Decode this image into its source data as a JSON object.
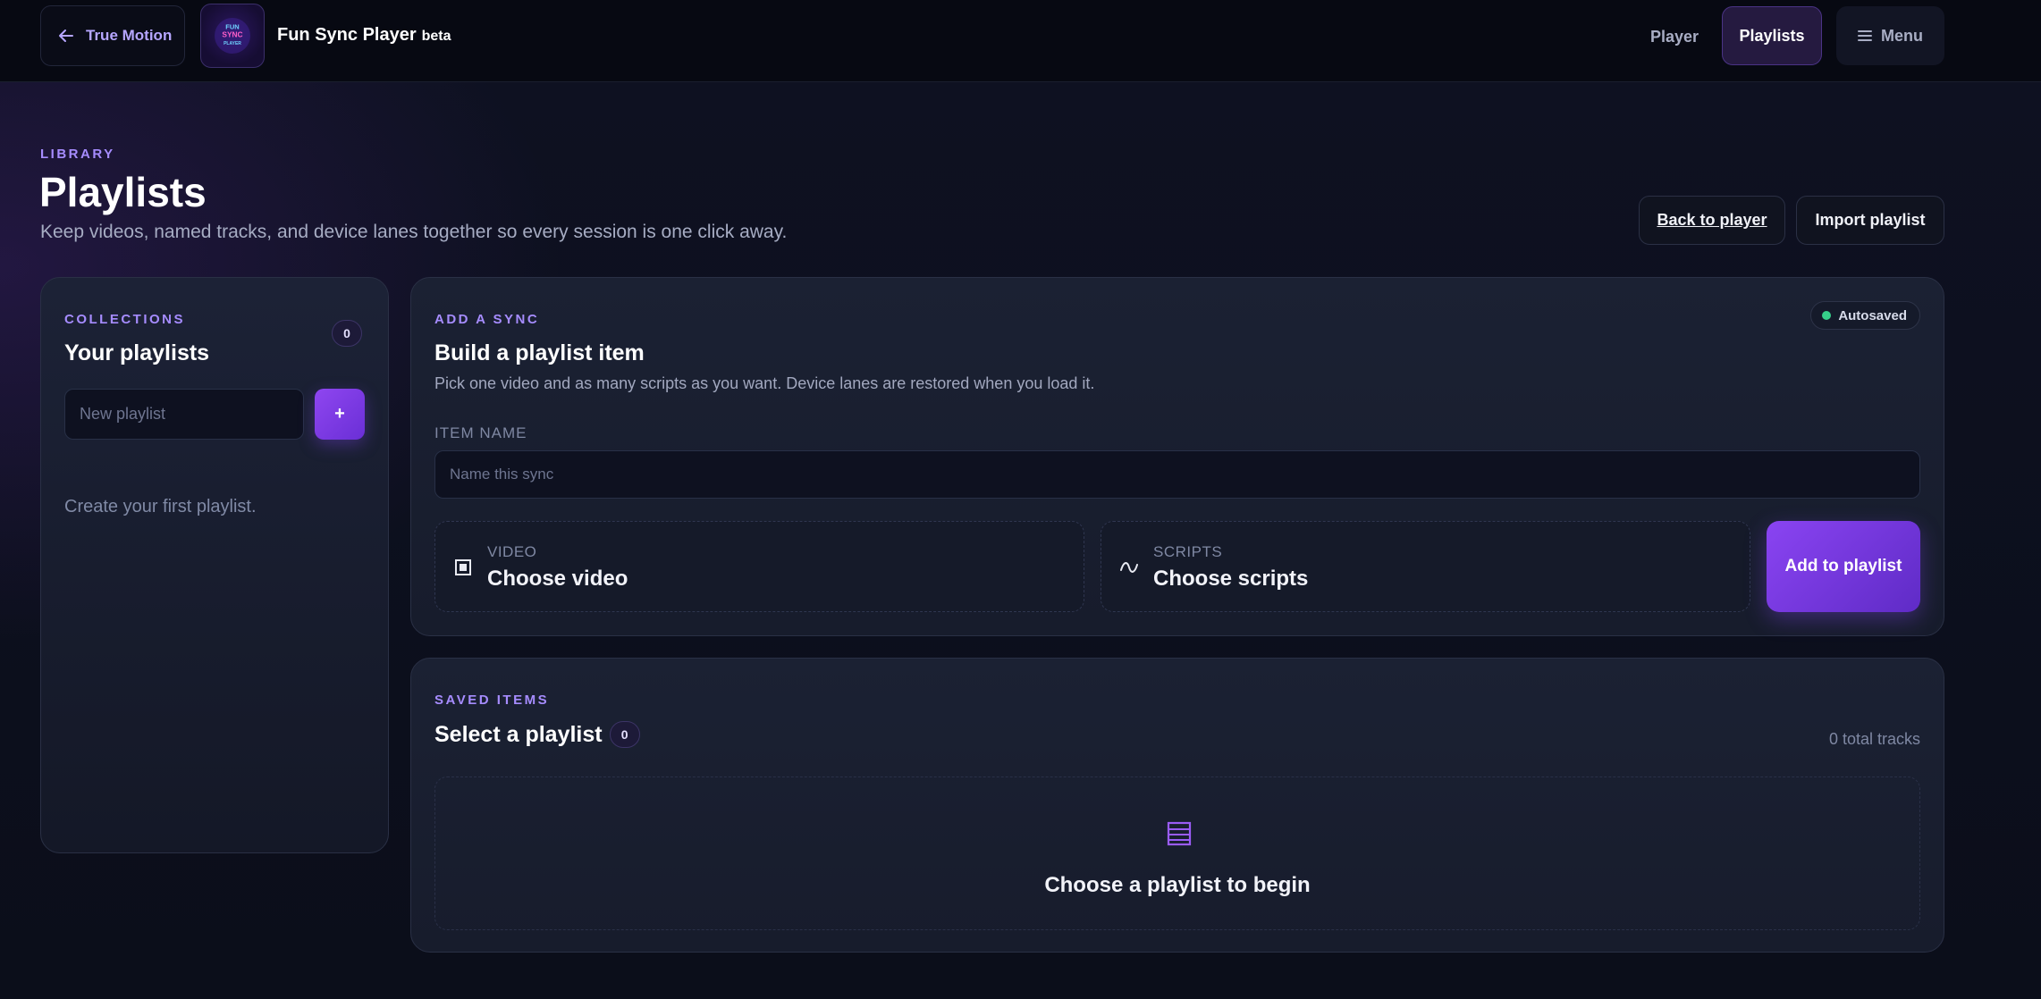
{
  "topbar": {
    "back_label": "True Motion",
    "logo_text": [
      "FUN",
      "SYNC",
      "PLAYER"
    ],
    "app_name": "Fun Sync Player",
    "app_tag": "beta",
    "nav": {
      "player": "Player",
      "playlists": "Playlists",
      "menu": "Menu"
    }
  },
  "header": {
    "eyebrow": "LIBRARY",
    "title": "Playlists",
    "subtitle": "Keep videos, named tracks, and device lanes together so every session is one click away.",
    "back_to_player": "Back to player",
    "import_playlist": "Import playlist"
  },
  "collections": {
    "eyebrow": "COLLECTIONS",
    "title": "Your playlists",
    "count": "0",
    "new_placeholder": "New playlist",
    "add_label": "+",
    "empty_text": "Create your first playlist."
  },
  "add_sync": {
    "eyebrow": "ADD A SYNC",
    "title": "Build a playlist item",
    "description": "Pick one video and as many scripts as you want. Device lanes are restored when you load it.",
    "status": "Autosaved",
    "item_name_label": "ITEM NAME",
    "item_name_placeholder": "Name this sync",
    "video_label": "VIDEO",
    "video_value": "Choose video",
    "scripts_label": "SCRIPTS",
    "scripts_value": "Choose scripts",
    "add_button": "Add to playlist"
  },
  "saved": {
    "eyebrow": "SAVED ITEMS",
    "title": "Select a playlist",
    "count": "0",
    "total_tracks": "0 total tracks",
    "empty_text": "Choose a playlist to begin"
  },
  "colors": {
    "accent": "#8f46f0",
    "eyebrow": "#a68cff",
    "success": "#36d08a",
    "background": "#0b0e1a"
  }
}
